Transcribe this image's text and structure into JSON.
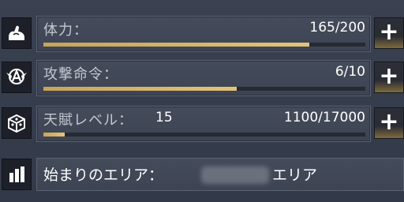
{
  "stats": [
    {
      "label": "体力：",
      "value": "165/200",
      "progress": 0.825,
      "icon": "flexed-arm-icon"
    },
    {
      "label": "攻撃命令：",
      "value": "6/10",
      "progress": 0.6,
      "icon": "winged-a-emblem-icon"
    },
    {
      "label": "天賦レベル：",
      "level": "15",
      "value": "1100/17000",
      "progress": 0.065,
      "icon": "talent-cube-icon"
    }
  ],
  "plus_label": "+",
  "area": {
    "label": "始まりのエリア：",
    "suffix": "エリア",
    "icon": "buildings-icon"
  },
  "colors": {
    "bar_fill": "#d9b86a",
    "panel_bg": "#424958",
    "tile_bg": "#1d2029"
  }
}
